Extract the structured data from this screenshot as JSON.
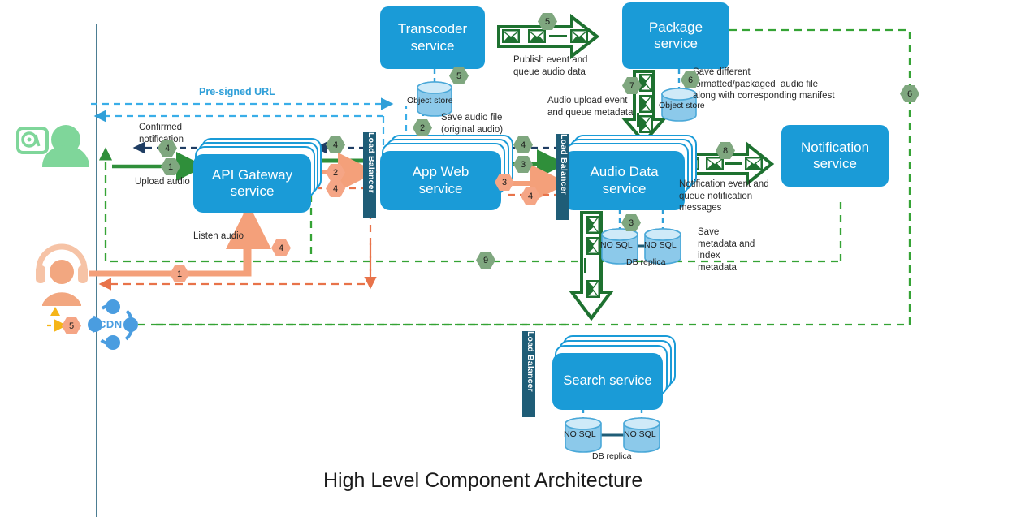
{
  "title": "High Level Component Architecture",
  "colors": {
    "service_blue": "#1a9bd7",
    "load_balancer": "#1f5d77",
    "queue_green": "#1e7130",
    "flow_green": "#35a335",
    "flow_orange": "#f08a5d",
    "flow_blue": "#2f9fd8",
    "flow_navy": "#1f3d63",
    "hex_green": "#7fa77f",
    "hex_orange": "#f5a585",
    "db_blue": "#8cc9ea",
    "user_green": "#7fd69a",
    "user_orange": "#f2a780",
    "cdn_blue": "#4a9de0",
    "boundary_line": "#1f5d77"
  },
  "services": [
    {
      "id": "transcoder",
      "label": "Transcoder\nservice",
      "stacked": false
    },
    {
      "id": "package",
      "label": "Package\nservice",
      "stacked": false
    },
    {
      "id": "api_gateway",
      "label": "API Gateway\nservice",
      "stacked": true
    },
    {
      "id": "app_web",
      "label": "App Web\nservice",
      "stacked": true
    },
    {
      "id": "audio_data",
      "label": "Audio Data\nservice",
      "stacked": true
    },
    {
      "id": "notification",
      "label": "Notification\nservice",
      "stacked": false
    },
    {
      "id": "search",
      "label": "Search service",
      "stacked": true
    }
  ],
  "load_balancers": [
    {
      "id": "lb_app",
      "label": "Load Balancer"
    },
    {
      "id": "lb_audio",
      "label": "Load Balancer"
    },
    {
      "id": "lb_search",
      "label": "Load Balancer"
    }
  ],
  "datastores": [
    {
      "id": "object_store_transcoder",
      "label": "Object store"
    },
    {
      "id": "object_store_package",
      "label": "Object store"
    },
    {
      "id": "audio_nosql_primary",
      "label": "NO SQL"
    },
    {
      "id": "audio_nosql_replica",
      "label": "NO SQL"
    },
    {
      "id": "audio_db_replica_label",
      "label": "DB replica"
    },
    {
      "id": "search_nosql_primary",
      "label": "NO SQL"
    },
    {
      "id": "search_nosql_replica",
      "label": "NO SQL"
    },
    {
      "id": "search_db_replica_label",
      "label": "DB replica"
    }
  ],
  "annotations": {
    "pre_signed_url": "Pre-signed URL",
    "confirmed_notification": "Confirmed\nnotification",
    "upload_audio": "Upload audio",
    "listen_audio": "Listen audio",
    "publish_event_queue_audio_data": "Publish event and\nqueue audio data",
    "save_audio_file": "Save audio file\n(original audio)",
    "audio_upload_event": "Audio upload event\nand queue metadata",
    "save_different_formatted": "Save different\nformatted/packaged  audio file\nalong with corresponding manifest",
    "notification_event": "Notification event and\nqueue notification\nmessages",
    "save_metadata_index": "Save\nmetadata and\nindex\nmetadata",
    "cdn": "CDN"
  },
  "step_badges": [
    {
      "id": "badge-upload-1",
      "value": "1",
      "color": "green"
    },
    {
      "id": "badge-confirmed-4",
      "value": "4",
      "color": "green"
    },
    {
      "id": "badge-listen-1",
      "value": "1",
      "color": "orange"
    },
    {
      "id": "badge-cdn-5",
      "value": "5",
      "color": "orange"
    },
    {
      "id": "badge-apigw-4",
      "value": "4",
      "color": "green"
    },
    {
      "id": "badge-apigw-2",
      "value": "2",
      "color": "orange"
    },
    {
      "id": "badge-apigw-4b",
      "value": "4",
      "color": "orange"
    },
    {
      "id": "badge-listen-4",
      "value": "4",
      "color": "orange"
    },
    {
      "id": "badge-objstore-2",
      "value": "2",
      "color": "green"
    },
    {
      "id": "badge-transcoder-5",
      "value": "5",
      "color": "green"
    },
    {
      "id": "badge-queue-5",
      "value": "5",
      "color": "green"
    },
    {
      "id": "badge-appweb-4",
      "value": "4",
      "color": "green"
    },
    {
      "id": "badge-appweb-3",
      "value": "3",
      "color": "green"
    },
    {
      "id": "badge-appweb-3o",
      "value": "3",
      "color": "orange"
    },
    {
      "id": "badge-appweb-4o",
      "value": "4",
      "color": "orange"
    },
    {
      "id": "badge-queue-7",
      "value": "7",
      "color": "green"
    },
    {
      "id": "badge-package-6",
      "value": "6",
      "color": "green"
    },
    {
      "id": "badge-notify-8",
      "value": "8",
      "color": "green"
    },
    {
      "id": "badge-nosql-3",
      "value": "3",
      "color": "green"
    },
    {
      "id": "badge-right-6",
      "value": "6",
      "color": "green"
    },
    {
      "id": "badge-bottom-9",
      "value": "9",
      "color": "green"
    }
  ],
  "actors": [
    {
      "id": "uploader",
      "kind": "person-with-record-icon",
      "color": "#7fd69a"
    },
    {
      "id": "listener",
      "kind": "person-with-headphones",
      "color": "#f2a780"
    }
  ]
}
